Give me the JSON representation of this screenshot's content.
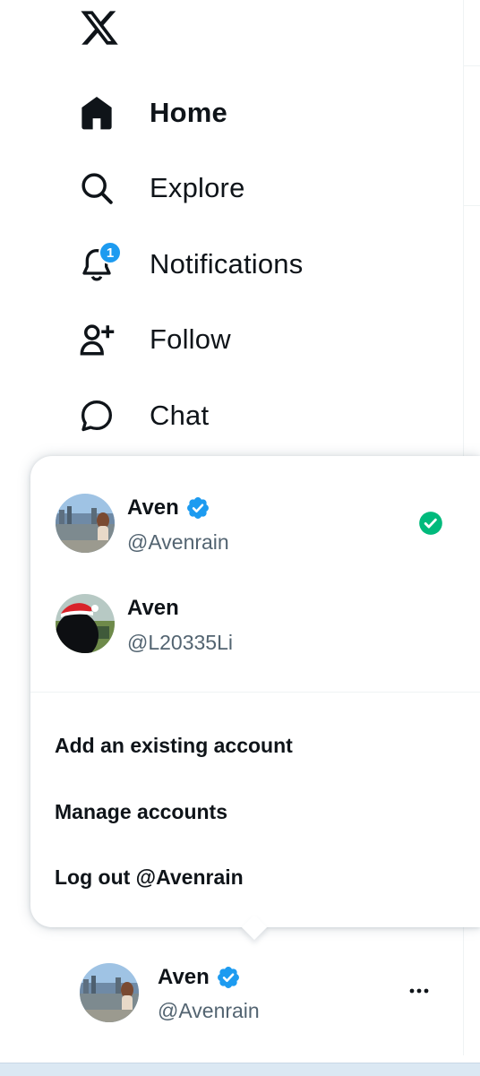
{
  "nav": {
    "items": [
      {
        "label": "Home",
        "icon": "home-icon"
      },
      {
        "label": "Explore",
        "icon": "search-icon"
      },
      {
        "label": "Notifications",
        "icon": "bell-icon",
        "badge": "1"
      },
      {
        "label": "Follow",
        "icon": "add-user-icon"
      },
      {
        "label": "Chat",
        "icon": "chat-icon"
      }
    ]
  },
  "popup": {
    "accounts": [
      {
        "name": "Aven",
        "handle": "@Avenrain",
        "verified": true,
        "active": true
      },
      {
        "name": "Aven",
        "handle": "@L20335Li",
        "verified": false,
        "active": false
      }
    ],
    "menu": [
      "Add an existing account",
      "Manage accounts",
      "Log out @Avenrain"
    ]
  },
  "switcher": {
    "name": "Aven",
    "handle": "@Avenrain"
  },
  "colors": {
    "accent": "#1d9bf0",
    "active_check": "#00ba7c",
    "text": "#0f1419",
    "muted": "#536471"
  }
}
